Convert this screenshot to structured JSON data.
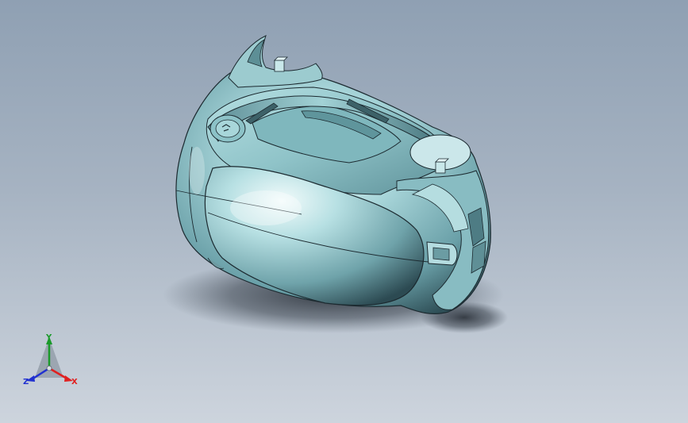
{
  "viewport": {
    "background_top": "#8fa0b3",
    "background_bottom": "#cdd4dd",
    "model_color": "#9ecfd3",
    "model_edge_color": "#1c2a30"
  },
  "triad": {
    "x_label": "X",
    "y_label": "Y",
    "z_label": "Z",
    "x_color": "#e02020",
    "y_color": "#1a9a2a",
    "z_color": "#2030d0"
  }
}
